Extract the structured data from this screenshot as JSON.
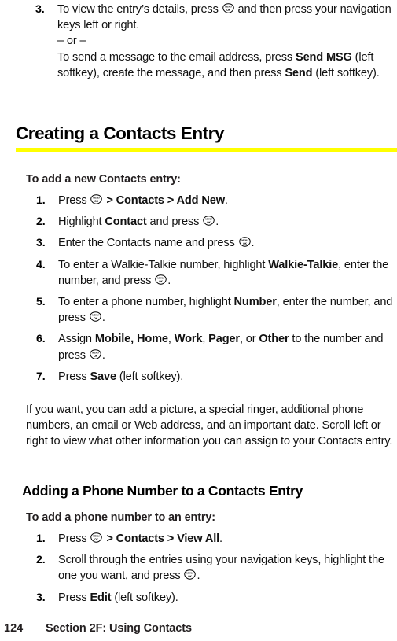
{
  "document": {
    "type": "phone-user-guide-page",
    "page_number": "124",
    "footer_section": "Section 2F: Using Contacts",
    "accent_color": "#ffff00",
    "text_color": "#231f20"
  },
  "icons": {
    "menu_ok_key": {
      "name": "menu-ok-key-icon",
      "top_label": "MENU",
      "bottom_label": "OK"
    }
  },
  "continued_list": {
    "items": [
      {
        "marker": "3.",
        "line1_a": "To view the entry’s details, press ",
        "line1_b": " and then press your navigation keys left or right.",
        "or_line": "– or –",
        "line2_a": "To send a message to the email address, press ",
        "line2_bold1": "Send MSG",
        "line2_b": " (left softkey), create the message, and then press ",
        "line2_bold2": "Send",
        "line2_c": " (left softkey)."
      }
    ]
  },
  "section_1": {
    "heading": "Creating a Contacts Entry",
    "leadin": "To add a new Contacts entry:",
    "steps": [
      {
        "marker": "1.",
        "a": "Press ",
        "bold1": " > Contacts > Add New",
        "b": "."
      },
      {
        "marker": "2.",
        "a": "Highlight ",
        "bold1": "Contact",
        "b": " and press ",
        "c": "."
      },
      {
        "marker": "3.",
        "a": "Enter the Contacts name and press ",
        "b": "."
      },
      {
        "marker": "4.",
        "a": "To enter a Walkie-Talkie number, highlight ",
        "bold1": "Walkie-Talkie",
        "b": ", enter the number, and press ",
        "c": "."
      },
      {
        "marker": "5.",
        "a": "To enter a phone number, highlight ",
        "bold1": "Number",
        "b": ", enter the number, and press ",
        "c": "."
      },
      {
        "marker": "6.",
        "a": "Assign ",
        "bold1": "Mobile,",
        "mid1": " ",
        "bold2": "Home",
        "mid2": ", ",
        "bold3": "Work",
        "mid3": ", ",
        "bold4": "Pager",
        "mid4": ", or ",
        "bold5": "Other",
        "b": " to the number and press ",
        "c": "."
      },
      {
        "marker": "7.",
        "a": "Press ",
        "bold1": "Save",
        "b": " (left softkey)."
      }
    ],
    "note": "If you want, you can add a picture, a special ringer, additional phone numbers, an email or Web address, and an important date. Scroll left or right to view what other information you can assign to your Contacts entry."
  },
  "section_2": {
    "heading": "Adding a Phone Number to a Contacts Entry",
    "leadin": "To add a phone number to an entry:",
    "steps": [
      {
        "marker": "1.",
        "a": "Press ",
        "bold1": " > Contacts > View All",
        "b": "."
      },
      {
        "marker": "2.",
        "a": "Scroll through the entries using your navigation keys, highlight the one you want, and press ",
        "b": "."
      },
      {
        "marker": "3.",
        "a": "Press ",
        "bold1": "Edit",
        "b": " (left softkey)."
      }
    ]
  }
}
